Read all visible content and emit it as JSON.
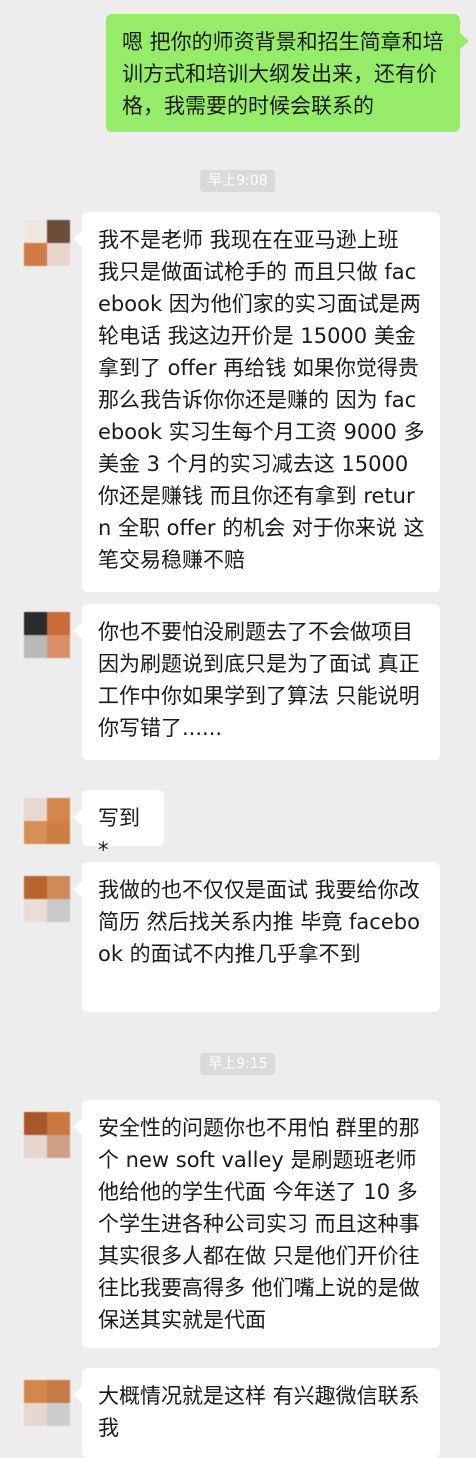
{
  "chat": {
    "outgoing": [
      {
        "text": "嗯 把你的师资背景和招生简章和培训方式和培训大纲发出来，还有价格，我需要的时候会联系的"
      }
    ],
    "timestamps": [
      "早上9:08",
      "早上9:15"
    ],
    "incoming": [
      {
        "text": "我不是老师 我现在在亚马逊上班 我只是做面试枪手的 而且只做 facebook 因为他们家的实习面试是两轮电话 我这边开价是 15000 美金 拿到了 offer 再给钱 如果你觉得贵 那么我告诉你你还是赚的 因为 facebook 实习生每个月工资 9000 多美金 3 个月的实习减去这 15000 你还是赚钱 而且你还有拿到 return 全职 offer 的机会 对于你来说 这笔交易稳赚不赔"
      },
      {
        "text": "你也不要怕没刷题去了不会做项目 因为刷题说到底只是为了面试 真正工作中你如果学到了算法 只能说明你写错了......"
      },
      {
        "text": "写到*"
      },
      {
        "text": "我做的也不仅仅是面试 我要给你改简历 然后找关系内推 毕竟 facebook 的面试不内推几乎拿不到"
      },
      {
        "text": "安全性的问题你也不用怕 群里的那个 new soft valley 是刷题班老师 他给他的学生代面 今年送了 10 多个学生进各种公司实习 而且这种事其实很多人都在做 只是他们开价往往比我要高得多 他们嘴上说的是做保送其实就是代面"
      },
      {
        "text": "大概情况就是这样 有兴趣微信联系我"
      }
    ]
  },
  "colors": {
    "background": "#ededed",
    "outgoing_bubble": "#95ec69",
    "incoming_bubble": "#ffffff",
    "timestamp_bg": "#dadada"
  }
}
